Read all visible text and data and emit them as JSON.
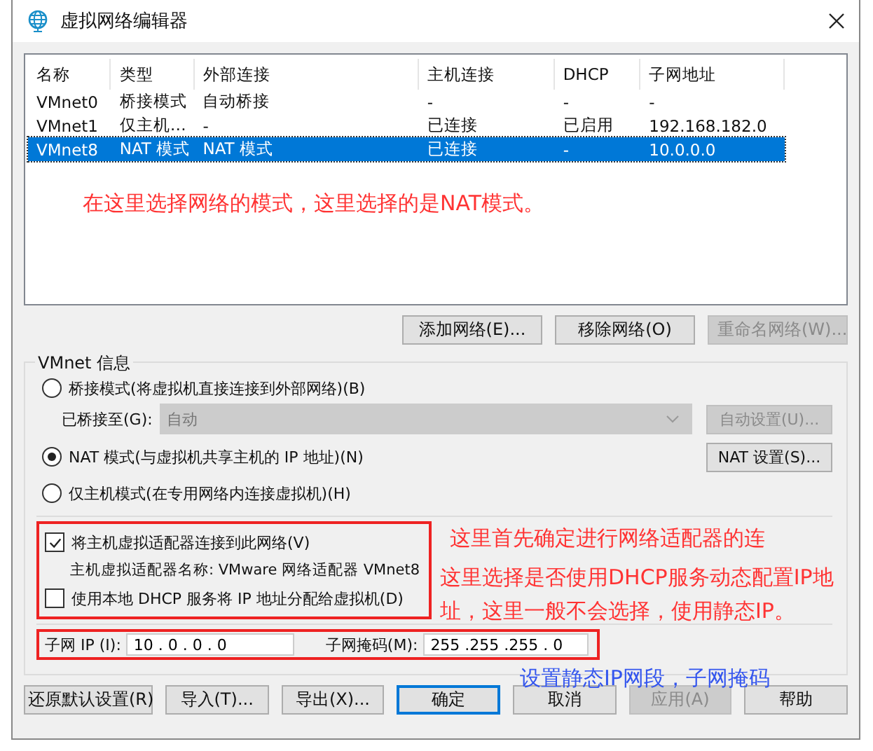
{
  "window": {
    "title": "虚拟网络编辑器"
  },
  "table": {
    "columns": [
      "名称",
      "类型",
      "外部连接",
      "主机连接",
      "DHCP",
      "子网地址"
    ],
    "rows": [
      {
        "cells": [
          "VMnet0",
          "桥接模式",
          "自动桥接",
          "-",
          "-",
          "-"
        ],
        "selected": false
      },
      {
        "cells": [
          "VMnet1",
          "仅主机…",
          "-",
          "已连接",
          "已启用",
          "192.168.182.0"
        ],
        "selected": false
      },
      {
        "cells": [
          "VMnet8",
          "NAT 模式",
          "NAT 模式",
          "已连接",
          "-",
          "10.0.0.0"
        ],
        "selected": true
      }
    ]
  },
  "network_buttons": [
    {
      "label": "添加网络(E)...",
      "disabled": false
    },
    {
      "label": "移除网络(O)",
      "disabled": false
    },
    {
      "label": "重命名网络(W)...",
      "disabled": true
    }
  ],
  "vmnet_info": {
    "title": "VMnet 信息",
    "modes": [
      {
        "label": "桥接模式(将虚拟机直接连接到外部网络)(B)",
        "selected": false
      },
      {
        "label": "NAT 模式(与虚拟机共享主机的 IP 地址)(N)",
        "selected": true
      },
      {
        "label": "仅主机模式(在专用网络内连接虚拟机)(H)",
        "selected": false
      }
    ],
    "bridged_to": {
      "label": "已桥接至(G):",
      "value": "自动",
      "disabled": true
    },
    "auto_settings_button": {
      "label": "自动设置(U)...",
      "disabled": true
    },
    "nat_settings_button": {
      "label": "NAT 设置(S)...",
      "disabled": false
    },
    "options": [
      {
        "label": "将主机虚拟适配器连接到此网络(V)",
        "checked": true
      },
      {
        "label": "使用本地 DHCP 服务将 IP 地址分配给虚拟机(D)",
        "checked": false
      }
    ],
    "adapter_name": "主机虚拟适配器名称: VMware 网络适配器 VMnet8",
    "subnet_ip": {
      "label": "子网 IP (I):",
      "value": "10 . 0 . 0 . 0"
    },
    "subnet_mask": {
      "label": "子网掩码(M):",
      "value": "255 .255 .255 . 0"
    }
  },
  "footer_buttons": [
    {
      "label": "还原默认设置(R)",
      "disabled": false,
      "default": false
    },
    {
      "label": "导入(T)...",
      "disabled": false,
      "default": false
    },
    {
      "label": "导出(X)...",
      "disabled": false,
      "default": false
    },
    {
      "label": "确定",
      "disabled": false,
      "default": true
    },
    {
      "label": "取消",
      "disabled": false,
      "default": false
    },
    {
      "label": "应用(A)",
      "disabled": true,
      "default": false
    },
    {
      "label": "帮助",
      "disabled": false,
      "default": false
    }
  ],
  "annotations": [
    {
      "text": "在这里选择网络的模式，这里选择的是NAT模式。",
      "color": "#ff3333"
    },
    {
      "text": "这里首先确定进行网络适配器的连",
      "color": "#ff3333"
    },
    {
      "text": "这里选择是否使用DHCP服务动态配置IP地址，这里一般不会选择，使用静态IP。",
      "color": "#ff3333"
    },
    {
      "text": "设置静态IP网段，子网掩码",
      "color": "#3355ee"
    }
  ]
}
